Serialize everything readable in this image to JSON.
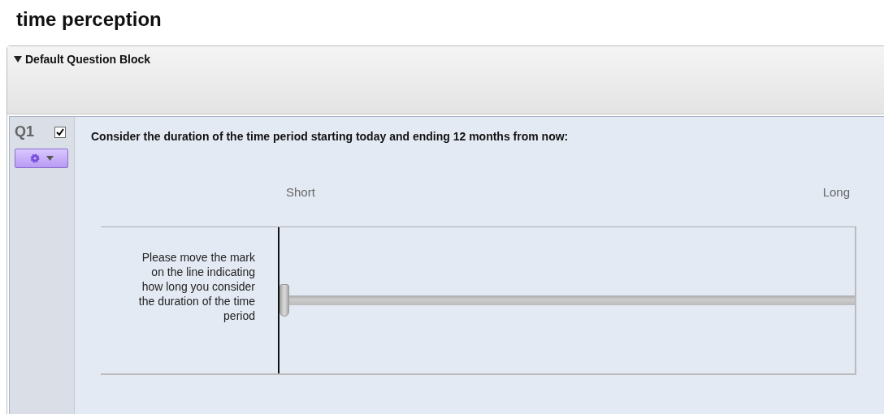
{
  "survey_title": "time perception",
  "block": {
    "title": "Default Question Block",
    "expanded": true
  },
  "question": {
    "number": "Q1",
    "checked": true,
    "text": "Consider the duration of the time period starting today and ending 12 months from now:",
    "scale_labels": [
      "Short",
      "Long"
    ],
    "slider": {
      "label": "Please move the mark on the line indicating how long you consider the duration of the time period",
      "level": 0
    }
  }
}
